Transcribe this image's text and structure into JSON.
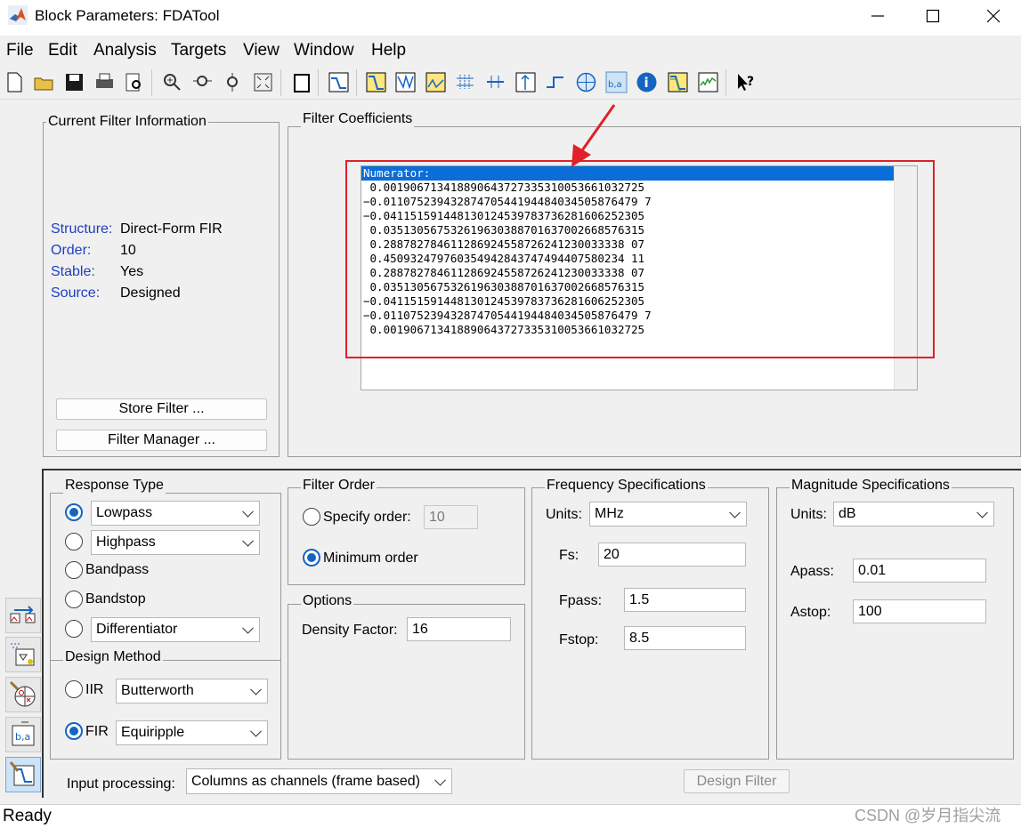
{
  "window": {
    "title": "Block Parameters: FDATool",
    "minimize": "minimize",
    "maximize": "maximize",
    "close": "close"
  },
  "menu": [
    "File",
    "Edit",
    "Analysis",
    "Targets",
    "View",
    "Window",
    "Help"
  ],
  "toolbar_icons": [
    "new-icon",
    "open-icon",
    "save-icon",
    "print-icon",
    "print-preview-icon",
    "zoom-in-icon",
    "zoom-x-icon",
    "zoom-y-icon",
    "full-view-icon",
    "new-window-icon",
    "filter-specs-icon",
    "magnitude-response-icon",
    "phase-response-icon",
    "mag-phase-icon",
    "group-delay-icon",
    "phase-delay-icon",
    "impulse-response-icon",
    "step-response-icon",
    "pole-zero-icon",
    "filter-coefficients-icon",
    "filter-info-icon",
    "magnitude-estimate-icon",
    "round-off-noise-icon",
    "whats-this-icon"
  ],
  "current_filter": {
    "label": "Current Filter Information",
    "structure_label": "Structure:",
    "structure_value": "Direct-Form FIR",
    "order_label": "Order:",
    "order_value": "10",
    "stable_label": "Stable:",
    "stable_value": "Yes",
    "source_label": "Source:",
    "source_value": "Designed",
    "store_button": "Store Filter ...",
    "manager_button": "Filter Manager ..."
  },
  "coefficients": {
    "label": "Filter Coefficients",
    "header": "Numerator:",
    "rows": [
      " 0.001906713418890643727335310053661032725",
      "−0.01107523943287470544194484034505876479 7",
      "−0.041151591448130124539783736281606252305",
      " 0.035130567532619630388701637002668576315",
      " 0.288782784611286924558726241230033338 07",
      " 0.450932479760354942843747494407580234 11",
      " 0.288782784611286924558726241230033338 07",
      " 0.035130567532619630388701637002668576315",
      "−0.041151591448130124539783736281606252305",
      "−0.01107523943287470544194484034505876479 7",
      " 0.001906713418890643727335310053661032725"
    ]
  },
  "response_type": {
    "label": "Response Type",
    "lowpass": "Lowpass",
    "highpass": "Highpass",
    "bandpass": "Bandpass",
    "bandstop": "Bandstop",
    "differentiator": "Differentiator"
  },
  "design_method": {
    "label": "Design Method",
    "iir_label": "IIR",
    "iir_value": "Butterworth",
    "fir_label": "FIR",
    "fir_value": "Equiripple"
  },
  "filter_order": {
    "label": "Filter Order",
    "specify": "Specify order:",
    "specify_value": "10",
    "minimum": "Minimum order"
  },
  "options": {
    "label": "Options",
    "density_label": "Density Factor:",
    "density_value": "16"
  },
  "frequency": {
    "label": "Frequency Specifications",
    "units_label": "Units:",
    "units_value": "MHz",
    "fs_label": "Fs:",
    "fs_value": "20",
    "fpass_label": "Fpass:",
    "fpass_value": "1.5",
    "fstop_label": "Fstop:",
    "fstop_value": "8.5"
  },
  "magnitude": {
    "label": "Magnitude Specifications",
    "units_label": "Units:",
    "units_value": "dB",
    "apass_label": "Apass:",
    "apass_value": "0.01",
    "astop_label": "Astop:",
    "astop_value": "100"
  },
  "input_processing": {
    "label": "Input processing:",
    "value": "Columns as channels (frame based)"
  },
  "design_button": "Design Filter",
  "status": "Ready",
  "watermark": "CSDN @岁月指尖流",
  "colors": {
    "accent": "#1565c0",
    "selection": "#0b6dd7",
    "annotation": "#e0202a"
  }
}
